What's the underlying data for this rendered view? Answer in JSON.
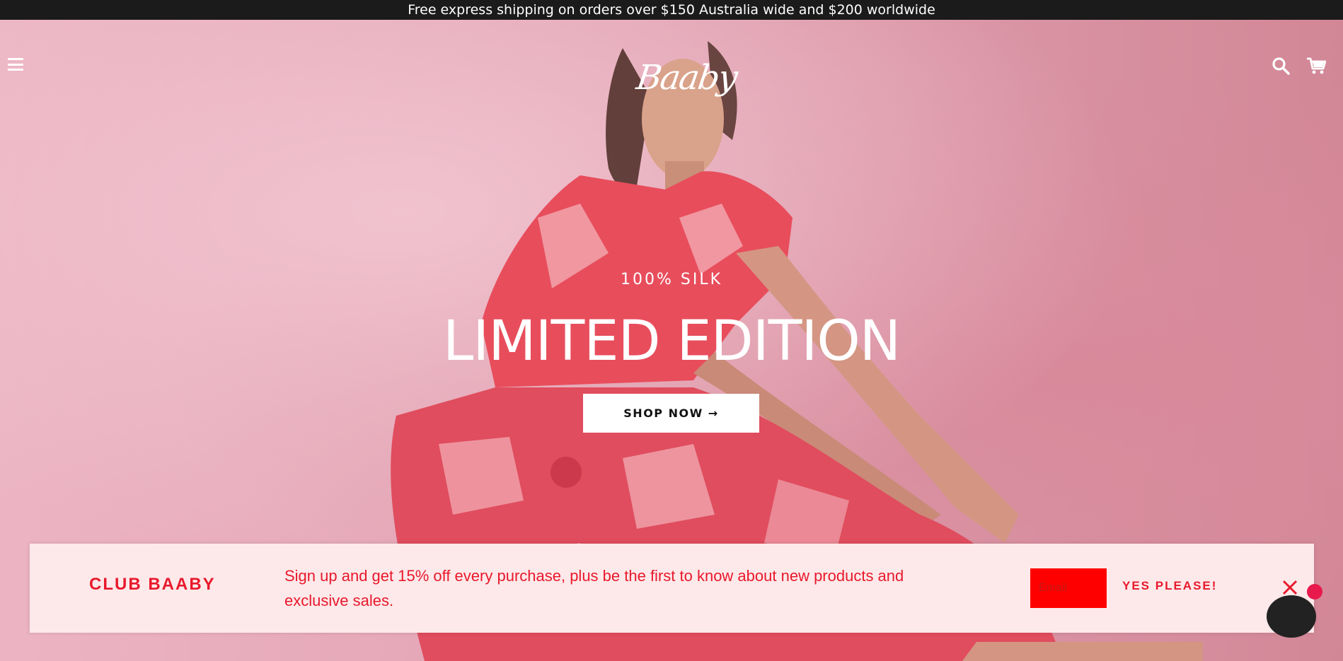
{
  "announcement": {
    "text": "Free express shipping on orders over $150 Australia wide and $200 worldwide"
  },
  "header": {
    "logo_text": "Baaby",
    "menu_icon": "hamburger-menu-icon",
    "search_icon": "search-icon",
    "cart_icon": "cart-icon"
  },
  "hero": {
    "eyebrow": "100% SILK",
    "headline": "LIMITED EDITION",
    "cta_label": "SHOP NOW →"
  },
  "newsletter": {
    "title": "CLUB BAABY",
    "text": "Sign up and get 15% off every purchase, plus be the first to know about new products and exclusive sales.",
    "email_placeholder": "Email",
    "submit_label": "YES PLEASE!",
    "close_icon": "close-icon"
  },
  "colors": {
    "announcement_bg": "#1b1b1b",
    "hero_bg": "#e4a9b8",
    "accent_red": "#e8192c",
    "popup_bg": "#fde9ea",
    "input_bg": "#ff0000"
  }
}
